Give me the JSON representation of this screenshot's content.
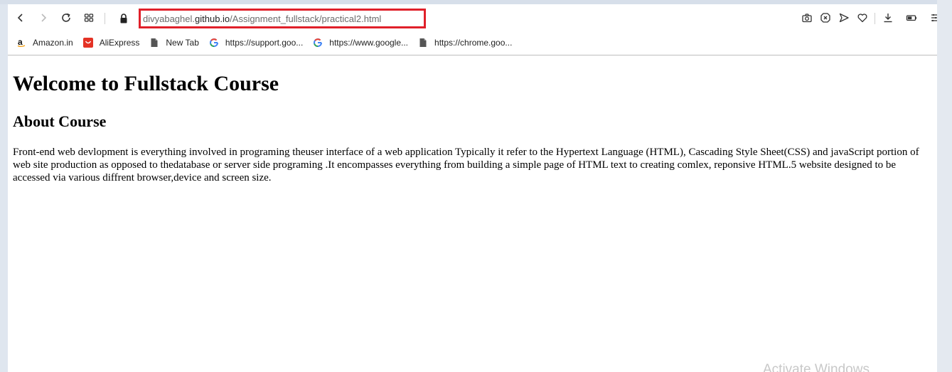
{
  "browser": {
    "url_host_prefix": "divyabaghel.",
    "url_host": "github.io",
    "url_path": "/Assignment_fullstack/practical2.html",
    "accent_color": "#e0202a"
  },
  "bookmarks": [
    {
      "label": "Amazon.in",
      "icon": "amazon-icon"
    },
    {
      "label": "AliExpress",
      "icon": "aliexpress-icon"
    },
    {
      "label": "New Tab",
      "icon": "page-icon"
    },
    {
      "label": "https://support.goo...",
      "icon": "google-icon"
    },
    {
      "label": "https://www.google...",
      "icon": "google-icon"
    },
    {
      "label": "https://chrome.goo...",
      "icon": "page-icon"
    }
  ],
  "page": {
    "heading": "Welcome to Fullstack Course",
    "subheading": "About Course",
    "paragraph": "Front-end web devlopment is everything involved in programing theuser interface of a web application Typically it refer to the Hypertext Language (HTML), Cascading Style Sheet(CSS) and javaScript portion of web site production as opposed to thedatabase or server side programing .It encompasses everything from building a simple page of HTML text to creating comlex, reponsive HTML.5 website designed to be accessed via various diffrent browser,device and screen size."
  },
  "watermark": "Activate Windows"
}
